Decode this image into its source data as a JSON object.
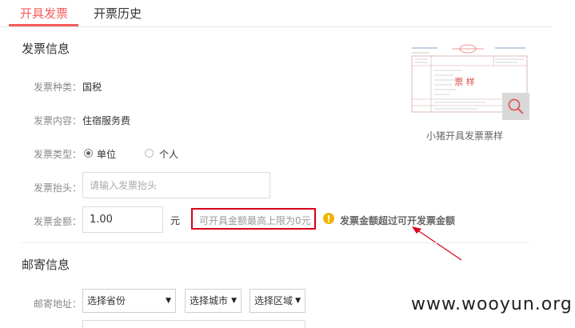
{
  "tabs": [
    {
      "label": "开具发票",
      "active": true
    },
    {
      "label": "开票历史",
      "active": false
    }
  ],
  "invoice_section": {
    "title": "发票信息",
    "category_label": "发票种类：",
    "category_value": "国税",
    "content_label": "发票内容：",
    "content_value": "住宿服务费",
    "type_label": "发票类型：",
    "type_options": [
      {
        "label": "单位",
        "checked": true
      },
      {
        "label": "个人",
        "checked": false
      }
    ],
    "header_label": "发票抬头：",
    "header_placeholder": "请输入发票抬头",
    "amount_label": "发票金额：",
    "amount_value": "1.00",
    "amount_unit": "元",
    "limit_hint": "可开具金额最高上限为0元",
    "error_message": "发票金额超过可开发票金额"
  },
  "sample": {
    "caption": "小猪开具发票票样",
    "stamp_text": "票 样",
    "zoom_icon": "magnifier-icon"
  },
  "mail_section": {
    "title": "邮寄信息",
    "address_label": "邮寄地址：",
    "province": "选择省份",
    "city": "选择城市",
    "district": "选择区域"
  },
  "watermark": "www.wooyun.org",
  "colors": {
    "accent": "#f55d5d",
    "highlight_box": "#d9001b",
    "warning": "#f0b400",
    "annotation_arrow": "#d9001b"
  }
}
